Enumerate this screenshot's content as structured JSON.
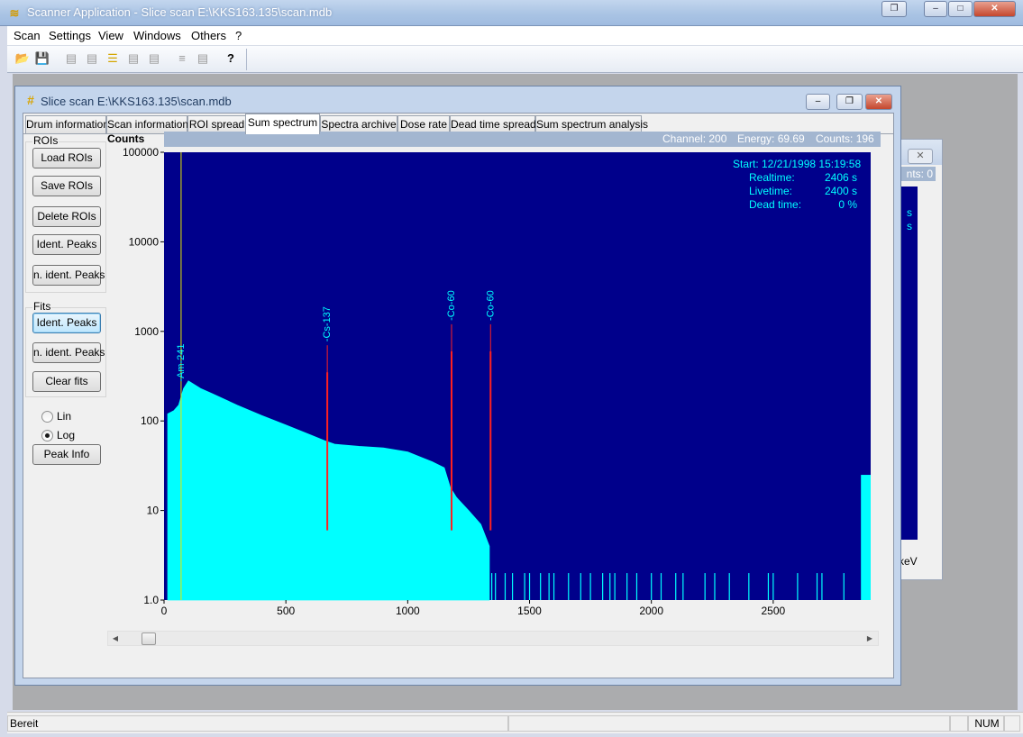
{
  "app": {
    "title": "Scanner Application - Slice scan E:\\KKS163.135\\scan.mdb",
    "menu": [
      "Scan",
      "Settings",
      "View",
      "Windows",
      "Others",
      "?"
    ],
    "controls": {
      "restore": "❐",
      "minimize": "–",
      "maximize": "□",
      "close": "✕"
    }
  },
  "toolbar": {
    "items": [
      {
        "icon": "folder-open-icon",
        "glyph": "📂"
      },
      {
        "icon": "save-disk-icon",
        "glyph": "💾"
      },
      {
        "icon": "layout-1-icon",
        "glyph": "▤"
      },
      {
        "icon": "layout-2-icon",
        "glyph": "▤"
      },
      {
        "icon": "layout-3-icon",
        "glyph": "☰"
      },
      {
        "icon": "layout-4-icon",
        "glyph": "▤"
      },
      {
        "icon": "layout-5-icon",
        "glyph": "▤"
      },
      {
        "icon": "layout-6-icon",
        "glyph": "≡"
      },
      {
        "icon": "layout-7-icon",
        "glyph": "▤"
      },
      {
        "icon": "help-icon",
        "glyph": "?"
      }
    ]
  },
  "status": {
    "text": "Bereit",
    "num": "NUM"
  },
  "bg_window": {
    "close": "✕",
    "header": "nts: 0",
    "s1": "s",
    "s2": "s",
    "kev": "keV"
  },
  "child": {
    "title": "Slice scan E:\\KKS163.135\\scan.mdb",
    "tabs": [
      "Drum information",
      "Scan information",
      "ROI spread",
      "Sum spectrum",
      "Spectra archive",
      "Dose rate",
      "Dead time spread",
      "Sum spectrum analysis"
    ],
    "selected_tab": "Sum spectrum"
  },
  "rois": {
    "label": "ROIs",
    "load": "Load ROIs",
    "save": "Save ROIs",
    "delete": "Delete ROIs",
    "ident": "Ident. Peaks",
    "nident": "n. ident. Peaks"
  },
  "fits": {
    "label": "Fits",
    "ident": "Ident. Peaks",
    "nident": "n. ident. Peaks",
    "clear": "Clear fits"
  },
  "scale": {
    "lin": "Lin",
    "log": "Log",
    "selected": "Log"
  },
  "peak_info": "Peak Info",
  "chart_header": {
    "channel": "Channel: 200",
    "energy": "Energy: 69.69",
    "counts": "Counts: 196"
  },
  "chart_data": {
    "type": "area",
    "ylabel": "Counts",
    "yscale": "log",
    "ylim": [
      1,
      100000
    ],
    "xlim": [
      0,
      2900
    ],
    "x_ticks": [
      "0",
      "500",
      "1000",
      "1500",
      "2000",
      "2500"
    ],
    "y_ticks": [
      "1.0",
      "10",
      "100",
      "1000",
      "10000",
      "100000"
    ],
    "info": {
      "start": "Start: 12/21/1998 15:19:58",
      "realtime_label": "Realtime:",
      "realtime": "2406 s",
      "livetime_label": "Livetime:",
      "livetime": "2400 s",
      "deadtime_label": "Dead time:",
      "deadtime": "0 %"
    },
    "marker_channel": 70,
    "peaks": [
      {
        "label": "Am-241",
        "x": 70,
        "y": 250
      },
      {
        "label": "Cs-137",
        "x": 670,
        "y": 700
      },
      {
        "label": "Co-60",
        "x": 1180,
        "y": 1200
      },
      {
        "label": "Co-60",
        "x": 1340,
        "y": 1200
      }
    ],
    "spectrum_envelope": {
      "x": [
        15,
        40,
        60,
        80,
        100,
        150,
        200,
        300,
        400,
        500,
        600,
        660,
        700,
        800,
        900,
        1000,
        1100,
        1150,
        1175,
        1200,
        1250,
        1300,
        1335
      ],
      "y": [
        120,
        130,
        150,
        230,
        280,
        230,
        200,
        150,
        115,
        90,
        70,
        60,
        55,
        52,
        50,
        45,
        35,
        30,
        18,
        14,
        10,
        7,
        4
      ]
    },
    "tail_channels": [
      1345,
      1360,
      1400,
      1430,
      1480,
      1500,
      1545,
      1580,
      1600,
      1660,
      1710,
      1750,
      1800,
      1830,
      1850,
      1900,
      1940,
      2000,
      2040,
      2100,
      2130,
      2220,
      2260,
      2320,
      2400,
      2480,
      2500,
      2600,
      2680,
      2700,
      2790
    ],
    "tail_end": {
      "x": [
        2860,
        2900
      ],
      "y": 25
    }
  }
}
